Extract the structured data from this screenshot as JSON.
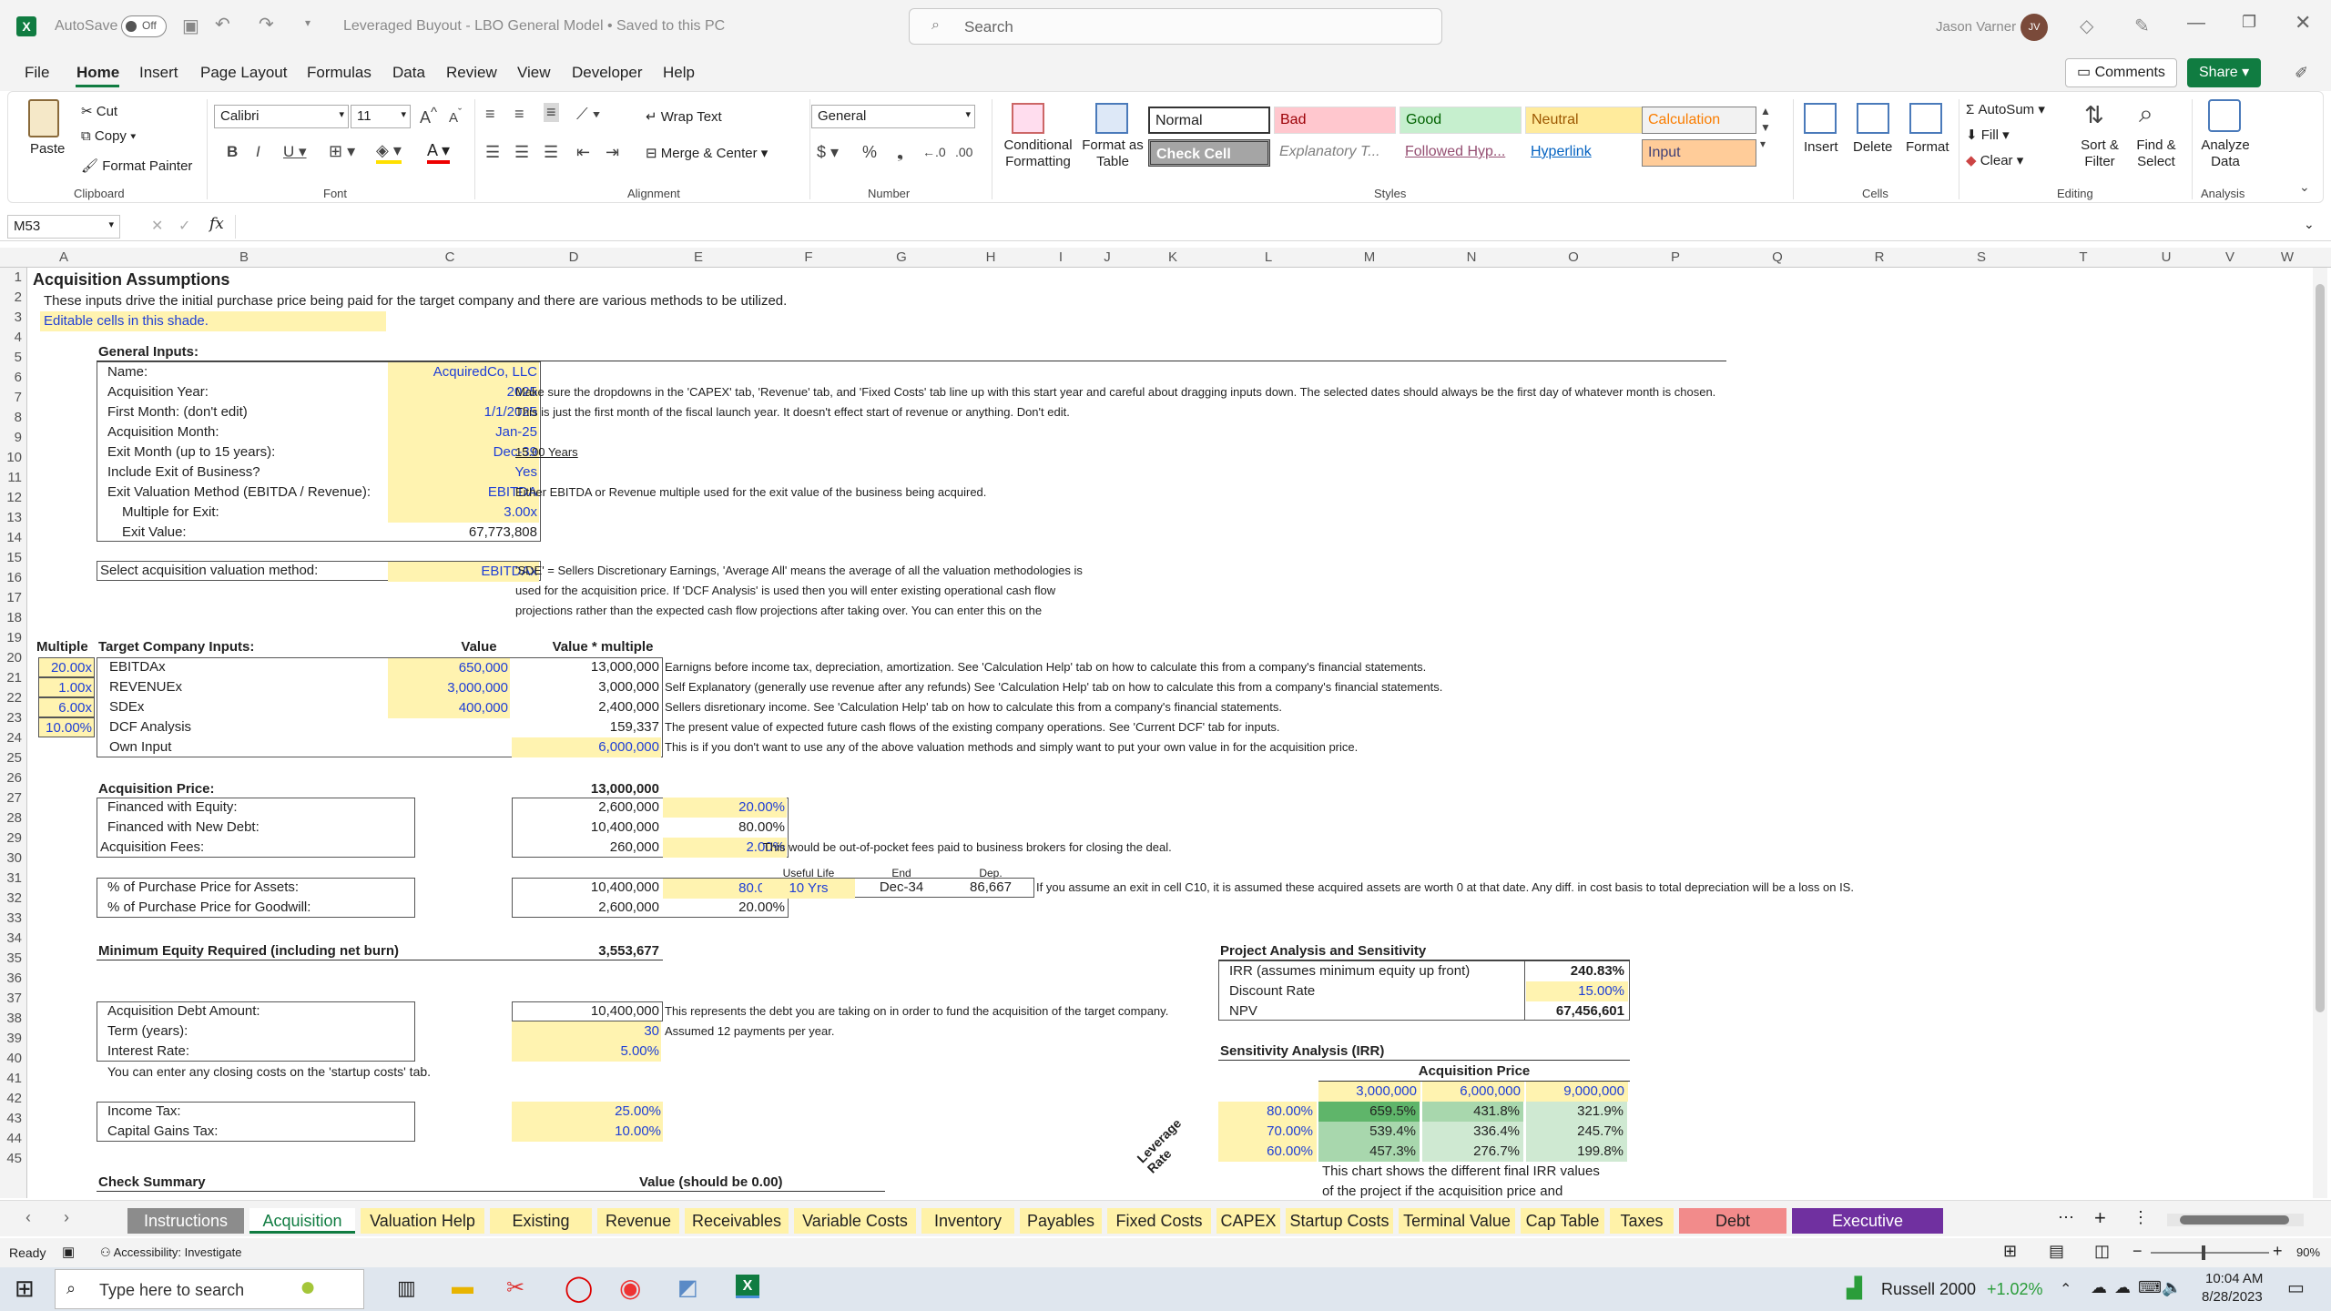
{
  "window": {
    "autosave_label": "AutoSave",
    "autosave_state": "Off",
    "title": "Leveraged Buyout - LBO General Model • Saved to this PC",
    "search_placeholder": "Search",
    "user_name": "Jason Varner",
    "user_initials": "JV"
  },
  "menu": [
    "File",
    "Home",
    "Insert",
    "Page Layout",
    "Formulas",
    "Data",
    "Review",
    "View",
    "Developer",
    "Help"
  ],
  "toolbar": {
    "comments": "Comments",
    "share": "Share"
  },
  "ribbon": {
    "clipboard": {
      "paste": "Paste",
      "cut": "Cut",
      "copy": "Copy",
      "format_painter": "Format Painter",
      "group": "Clipboard"
    },
    "font": {
      "name": "Calibri",
      "size": "11",
      "group": "Font"
    },
    "alignment": {
      "wrap": "Wrap Text",
      "merge": "Merge & Center",
      "group": "Alignment"
    },
    "number": {
      "format": "General",
      "group": "Number"
    },
    "styles": {
      "conditional": "Conditional Formatting",
      "format_table": "Format as Table",
      "normal": "Normal",
      "bad": "Bad",
      "good": "Good",
      "neutral": "Neutral",
      "calculation": "Calculation",
      "check_cell": "Check Cell",
      "explanatory": "Explanatory T...",
      "followed": "Followed Hyp...",
      "hyperlink": "Hyperlink",
      "input": "Input",
      "group": "Styles"
    },
    "cells": {
      "insert": "Insert",
      "delete": "Delete",
      "format": "Format",
      "group": "Cells"
    },
    "editing": {
      "autosum": "AutoSum",
      "fill": "Fill",
      "clear": "Clear",
      "sort": "Sort & Filter",
      "find": "Find & Select",
      "group": "Editing"
    },
    "analysis": {
      "analyze": "Analyze Data",
      "group": "Analysis"
    }
  },
  "formula_bar": {
    "name_box": "M53",
    "fx": "fx",
    "formula": ""
  },
  "columns": [
    "A",
    "B",
    "C",
    "D",
    "E",
    "F",
    "G",
    "H",
    "I",
    "J",
    "K",
    "L",
    "M",
    "N",
    "O",
    "P",
    "Q",
    "R",
    "S",
    "T",
    "U",
    "V",
    "W"
  ],
  "rows": [
    "1",
    "2",
    "3",
    "4",
    "5",
    "6",
    "7",
    "8",
    "9",
    "10",
    "11",
    "12",
    "13",
    "14",
    "15",
    "16",
    "17",
    "18",
    "19",
    "20",
    "21",
    "22",
    "23",
    "24",
    "25",
    "26",
    "27",
    "28",
    "29",
    "30",
    "31",
    "32",
    "33",
    "34",
    "35",
    "36",
    "37",
    "38",
    "39",
    "40",
    "41",
    "42",
    "43",
    "44",
    "45"
  ],
  "sheet": {
    "title": "Acquisition Assumptions",
    "subtitle": "These inputs drive the initial purchase price being paid for the target company and there are various methods to be utilized.",
    "editable_note": "Editable cells in this shade.",
    "general_inputs": "General Inputs:",
    "gen": [
      {
        "label": "Name:",
        "value": "AcquiredCo, LLC",
        "note": ""
      },
      {
        "label": "Acquisition Year:",
        "value": "2025",
        "note": "Make sure the dropdowns in the 'CAPEX' tab, 'Revenue' tab, and 'Fixed Costs' tab line up with this start year and careful about dragging inputs down. The selected dates should always be the first day of whatever month is chosen."
      },
      {
        "label": "First Month: (don't edit)",
        "value": "1/1/2025",
        "note": "This is just the first month of the fiscal launch year. It doesn't effect start of revenue or anything. Don't edit."
      },
      {
        "label": "Acquisition Month:",
        "value": "Jan-25",
        "note": ""
      },
      {
        "label": "Exit Month (up to 15 years):",
        "value": "Dec-39",
        "note": "15.00 Years"
      },
      {
        "label": "Include Exit of Business?",
        "value": "Yes",
        "note": ""
      },
      {
        "label": "Exit Valuation Method (EBITDA / Revenue):",
        "value": "EBITDA",
        "note": "Either EBITDA or Revenue multiple used for the exit value of the business being acquired."
      },
      {
        "label": "Multiple for Exit:",
        "value": "3.00x",
        "note": ""
      },
      {
        "label": "Exit Value:",
        "value": "67,773,808",
        "note": ""
      }
    ],
    "valuation_label": "Select acquisition valuation method:",
    "valuation_value": "EBITDAx",
    "valuation_note": [
      "'SDE' = Sellers Discretionary Earnings, 'Average All' means the average of all the valuation methodologies is",
      "used for the acquisition price. If 'DCF Analysis' is used then you will enter existing operational cash flow",
      "projections rather than the expected cash flow projections after taking over. You can enter this on the"
    ],
    "target_headers": {
      "multiple": "Multiple",
      "inputs": "Target Company Inputs:",
      "value": "Value",
      "value_mult": "Value * multiple"
    },
    "target": [
      {
        "mult": "20.00x",
        "label": "EBITDAx",
        "value": "650,000",
        "vm": "13,000,000",
        "note": "Earnigns before income tax, depreciation, amortization. See 'Calculation Help' tab on how to calculate this from a company's financial statements."
      },
      {
        "mult": "1.00x",
        "label": "REVENUEx",
        "value": "3,000,000",
        "vm": "3,000,000",
        "note": "Self Explanatory (generally use revenue after any refunds) See 'Calculation Help' tab on how to calculate this from a company's financial statements."
      },
      {
        "mult": "6.00x",
        "label": "SDEx",
        "value": "400,000",
        "vm": "2,400,000",
        "note": "Sellers disretionary income. See 'Calculation Help' tab on how to calculate this from a company's financial statements."
      },
      {
        "mult": "10.00%",
        "label": "DCF Analysis",
        "value": "",
        "vm": "159,337",
        "note": "The present value of expected future cash flows of the existing company operations. See 'Current DCF' tab for inputs."
      },
      {
        "mult": "",
        "label": "Own Input",
        "value": "",
        "vm": "6,000,000",
        "note": "This is if you don't want to use any of the above valuation methods and simply want to put your own value in for the acquisition price."
      }
    ],
    "acq_price_label": "Acquisition Price:",
    "acq_price_value": "13,000,000",
    "financing": [
      {
        "label": "Financed with Equity:",
        "value": "2,600,000",
        "pct": "20.00%",
        "note": ""
      },
      {
        "label": "Financed with New Debt:",
        "value": "10,400,000",
        "pct": "80.00%",
        "note": ""
      },
      {
        "label": "Acquisition Fees:",
        "value": "260,000",
        "pct": "2.00%",
        "note": "This would be out-of-pocket fees paid to business brokers for closing the deal."
      }
    ],
    "dep_headers": {
      "life": "Useful Life",
      "end": "End",
      "dep": "Dep."
    },
    "assets": {
      "label": "% of Purchase Price for Assets:",
      "value": "10,400,000",
      "pct": "80.00%",
      "life": "10 Yrs",
      "end": "Dec-34",
      "dep": "86,667",
      "note": "If you assume an exit in cell C10, it is assumed these acquired assets are worth 0 at that date. Any diff. in cost basis to total depreciation will be a loss on IS."
    },
    "goodwill": {
      "label": "% of Purchase Price for Goodwill:",
      "value": "2,600,000",
      "pct": "20.00%"
    },
    "min_equity_label": "Minimum Equity Required (including net burn)",
    "min_equity_value": "3,553,677",
    "debt": [
      {
        "label": "Acquisition Debt Amount:",
        "value": "10,400,000",
        "note": "This represents the debt you are taking on in order to fund the acquisition of the target company."
      },
      {
        "label": "Term (years):",
        "value": "30",
        "note": "Assumed 12 payments per year."
      },
      {
        "label": "Interest Rate:",
        "value": "5.00%",
        "note": ""
      }
    ],
    "closing_note": "You can enter any closing costs on the 'startup costs' tab.",
    "tax": [
      {
        "label": "Income Tax:",
        "value": "25.00%"
      },
      {
        "label": "Capital Gains Tax:",
        "value": "10.00%"
      }
    ],
    "check_summary": "Check Summary",
    "check_value_label": "Value (should be 0.00)",
    "project": {
      "title": "Project Analysis and Sensitivity",
      "rows": [
        {
          "label": "IRR (assumes minimum equity up front)",
          "value": "240.83%"
        },
        {
          "label": "Discount Rate",
          "value": "15.00%"
        },
        {
          "label": "NPV",
          "value": "67,456,601"
        }
      ]
    },
    "sensitivity": {
      "title": "Sensitivity Analysis (IRR)",
      "col_title": "Acquisition Price",
      "row_title": "Leverage Rate",
      "cols": [
        "3,000,000",
        "6,000,000",
        "9,000,000"
      ],
      "rows": [
        {
          "rate": "80.00%",
          "vals": [
            "659.5%",
            "431.8%",
            "321.9%"
          ]
        },
        {
          "rate": "70.00%",
          "vals": [
            "539.4%",
            "336.4%",
            "245.7%"
          ]
        },
        {
          "rate": "60.00%",
          "vals": [
            "457.3%",
            "276.7%",
            "199.8%"
          ]
        }
      ],
      "note": [
        "This chart shows the different final IRR values",
        "of the project if the acquisition price and"
      ]
    }
  },
  "tabs": [
    {
      "name": "Instructions",
      "bg": "#8c8c8c",
      "fg": "#ffffff"
    },
    {
      "name": "Acquisition",
      "bg": "#ffffff",
      "fg": "#107c41"
    },
    {
      "name": "Valuation Help",
      "bg": "#fff2a8",
      "fg": "#222222"
    },
    {
      "name": "Existing DCF",
      "bg": "#fff2a8",
      "fg": "#222222"
    },
    {
      "name": "Revenue",
      "bg": "#fff2a8",
      "fg": "#222222"
    },
    {
      "name": "Receivables",
      "bg": "#fff2a8",
      "fg": "#222222"
    },
    {
      "name": "Variable Costs",
      "bg": "#fff2a8",
      "fg": "#222222"
    },
    {
      "name": "Inventory",
      "bg": "#fff2a8",
      "fg": "#222222"
    },
    {
      "name": "Payables",
      "bg": "#fff2a8",
      "fg": "#222222"
    },
    {
      "name": "Fixed Costs",
      "bg": "#fff2a8",
      "fg": "#222222"
    },
    {
      "name": "CAPEX",
      "bg": "#fff2a8",
      "fg": "#222222"
    },
    {
      "name": "Startup Costs",
      "bg": "#fff2a8",
      "fg": "#222222"
    },
    {
      "name": "Terminal Value",
      "bg": "#fff2a8",
      "fg": "#222222"
    },
    {
      "name": "Cap Table",
      "bg": "#fff2a8",
      "fg": "#222222"
    },
    {
      "name": "Taxes",
      "bg": "#fff2a8",
      "fg": "#222222"
    },
    {
      "name": "Debt Schedule",
      "bg": "#f28b8b",
      "fg": "#222222"
    },
    {
      "name": "Executive Summary",
      "bg": "#7030a0",
      "fg": "#ffffff"
    }
  ],
  "status": {
    "ready": "Ready",
    "accessibility": "Accessibility: Investigate",
    "zoom": "90%"
  },
  "taskbar": {
    "search": "Type here to search",
    "ticker": "Russell 2000",
    "change": "+1.02%",
    "time": "10:04 AM",
    "date": "8/28/2023"
  },
  "colors": {
    "accent": "#107c41",
    "input_fill": "#fff3b0",
    "input_text": "#1f3fd6"
  }
}
